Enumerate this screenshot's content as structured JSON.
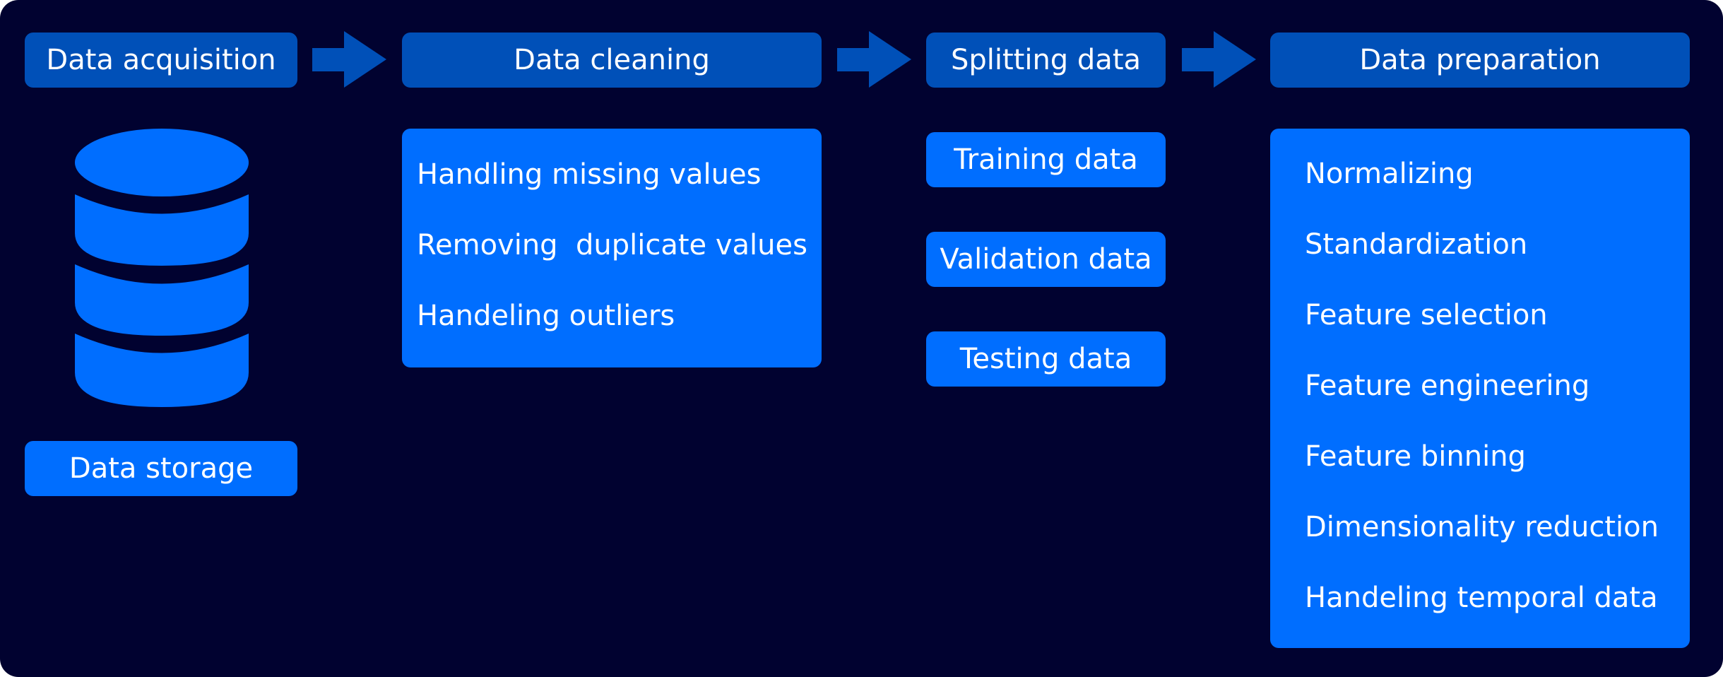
{
  "colors": {
    "background": "#010230",
    "header_fill": "#0050B8",
    "item_fill": "#006EFF",
    "text": "#FFFFFF"
  },
  "stages": {
    "acquisition": {
      "title": "Data acquisition",
      "icon": "database-icon",
      "storage_label": "Data storage"
    },
    "cleaning": {
      "title": "Data cleaning",
      "items": [
        "Handling missing values",
        "Removing  duplicate values",
        "Handeling outliers"
      ]
    },
    "splitting": {
      "title": "Splitting data",
      "items": [
        "Training data",
        "Validation data",
        "Testing data"
      ]
    },
    "preparation": {
      "title": "Data preparation",
      "items": [
        "Normalizing",
        "Standardization",
        "Feature selection",
        "Feature engineering",
        "Feature binning",
        "Dimensionality reduction",
        "Handeling temporal data"
      ]
    }
  },
  "arrows": [
    "arrow-right-icon",
    "arrow-right-icon",
    "arrow-right-icon"
  ]
}
